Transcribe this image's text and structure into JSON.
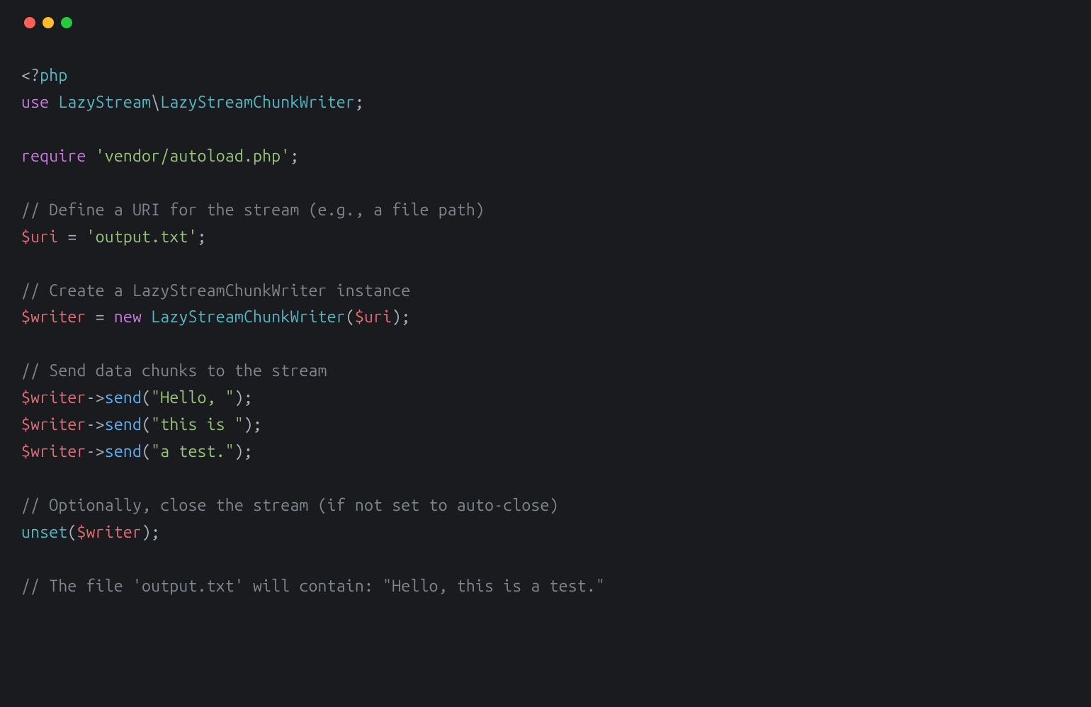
{
  "titlebar": {
    "buttons": [
      "close",
      "minimize",
      "zoom"
    ]
  },
  "code": {
    "language": "php",
    "lines": [
      {
        "tokens": [
          {
            "t": "<?",
            "c": "t-phpopen"
          },
          {
            "t": "php",
            "c": "t-cls"
          }
        ]
      },
      {
        "tokens": [
          {
            "t": "use",
            "c": "t-use"
          },
          {
            "t": " ",
            "c": "t-def"
          },
          {
            "t": "LazyStream",
            "c": "t-cls"
          },
          {
            "t": "\\",
            "c": "t-punct"
          },
          {
            "t": "LazyStreamChunkWriter",
            "c": "t-cls"
          },
          {
            "t": ";",
            "c": "t-punct"
          }
        ]
      },
      {
        "tokens": []
      },
      {
        "tokens": [
          {
            "t": "require",
            "c": "t-require"
          },
          {
            "t": " ",
            "c": "t-def"
          },
          {
            "t": "'vendor/autoload.php'",
            "c": "t-str"
          },
          {
            "t": ";",
            "c": "t-punct"
          }
        ]
      },
      {
        "tokens": []
      },
      {
        "tokens": [
          {
            "t": "// Define a URI for the stream (e.g., a file path)",
            "c": "t-cmt"
          }
        ]
      },
      {
        "tokens": [
          {
            "t": "$uri",
            "c": "t-var"
          },
          {
            "t": " = ",
            "c": "t-op"
          },
          {
            "t": "'output.txt'",
            "c": "t-str"
          },
          {
            "t": ";",
            "c": "t-punct"
          }
        ]
      },
      {
        "tokens": []
      },
      {
        "tokens": [
          {
            "t": "// Create a LazyStreamChunkWriter instance",
            "c": "t-cmt"
          }
        ]
      },
      {
        "tokens": [
          {
            "t": "$writer",
            "c": "t-var"
          },
          {
            "t": " = ",
            "c": "t-op"
          },
          {
            "t": "new",
            "c": "t-new"
          },
          {
            "t": " ",
            "c": "t-def"
          },
          {
            "t": "LazyStreamChunkWriter",
            "c": "t-cls"
          },
          {
            "t": "(",
            "c": "t-punct"
          },
          {
            "t": "$uri",
            "c": "t-var"
          },
          {
            "t": ");",
            "c": "t-punct"
          }
        ]
      },
      {
        "tokens": []
      },
      {
        "tokens": [
          {
            "t": "// Send data chunks to the stream",
            "c": "t-cmt"
          }
        ]
      },
      {
        "tokens": [
          {
            "t": "$writer",
            "c": "t-var"
          },
          {
            "t": "->",
            "c": "t-arrow"
          },
          {
            "t": "send",
            "c": "t-fn"
          },
          {
            "t": "(",
            "c": "t-punct"
          },
          {
            "t": "\"Hello, \"",
            "c": "t-str"
          },
          {
            "t": ");",
            "c": "t-punct"
          }
        ]
      },
      {
        "tokens": [
          {
            "t": "$writer",
            "c": "t-var"
          },
          {
            "t": "->",
            "c": "t-arrow"
          },
          {
            "t": "send",
            "c": "t-fn"
          },
          {
            "t": "(",
            "c": "t-punct"
          },
          {
            "t": "\"this is \"",
            "c": "t-str"
          },
          {
            "t": ");",
            "c": "t-punct"
          }
        ]
      },
      {
        "tokens": [
          {
            "t": "$writer",
            "c": "t-var"
          },
          {
            "t": "->",
            "c": "t-arrow"
          },
          {
            "t": "send",
            "c": "t-fn"
          },
          {
            "t": "(",
            "c": "t-punct"
          },
          {
            "t": "\"a test.\"",
            "c": "t-str"
          },
          {
            "t": ");",
            "c": "t-punct"
          }
        ]
      },
      {
        "tokens": []
      },
      {
        "tokens": [
          {
            "t": "// Optionally, close the stream (if not set to auto-close)",
            "c": "t-cmt"
          }
        ]
      },
      {
        "tokens": [
          {
            "t": "unset",
            "c": "t-unset"
          },
          {
            "t": "(",
            "c": "t-punct"
          },
          {
            "t": "$writer",
            "c": "t-var"
          },
          {
            "t": ");",
            "c": "t-punct"
          }
        ]
      },
      {
        "tokens": []
      },
      {
        "tokens": [
          {
            "t": "// The file 'output.txt' will contain: \"Hello, this is a test.\"",
            "c": "t-cmt"
          }
        ]
      }
    ]
  }
}
